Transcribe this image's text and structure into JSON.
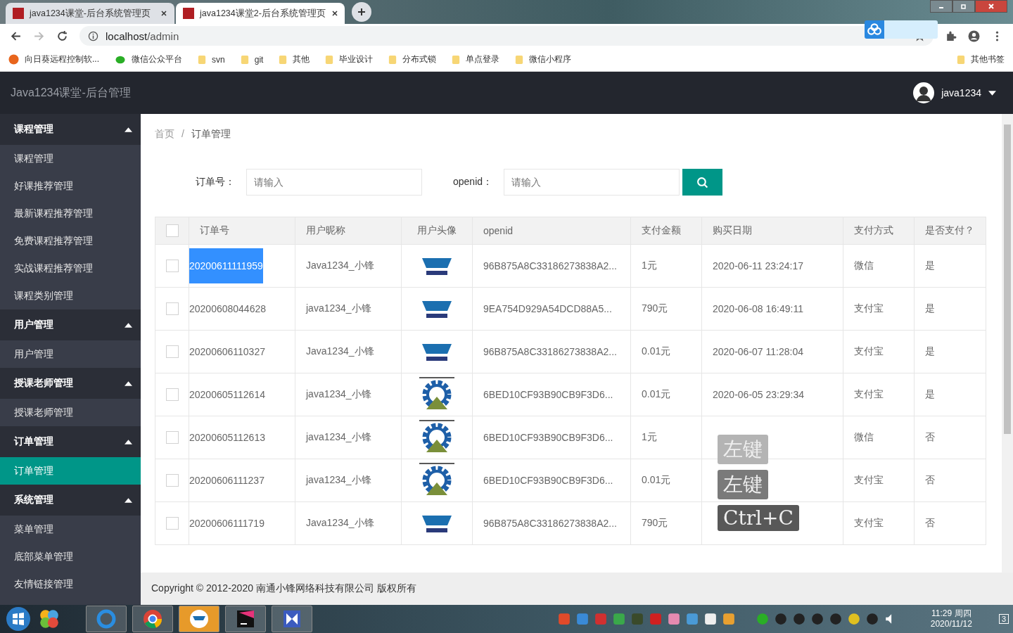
{
  "browser": {
    "tabs": [
      {
        "title": "java1234课堂-后台系统管理页",
        "selected": false
      },
      {
        "title": "java1234课堂2-后台系统管理页",
        "selected": true
      }
    ],
    "address": {
      "host": "localhost",
      "path": "/admin"
    },
    "bookmarks": [
      {
        "label": "向日葵远程控制软...",
        "kind": "app"
      },
      {
        "label": "微信公众平台",
        "kind": "wechat"
      },
      {
        "label": "svn",
        "kind": "folder"
      },
      {
        "label": "git",
        "kind": "folder"
      },
      {
        "label": "其他",
        "kind": "folder"
      },
      {
        "label": "毕业设计",
        "kind": "folder"
      },
      {
        "label": "分布式锁",
        "kind": "folder"
      },
      {
        "label": "单点登录",
        "kind": "folder"
      },
      {
        "label": "微信小程序",
        "kind": "folder"
      }
    ],
    "other_bookmarks": "其他书签"
  },
  "header": {
    "title": "Java1234课堂-后台管理",
    "user": "java1234"
  },
  "sidebar": [
    {
      "label": "课程管理",
      "expanded": true,
      "children": [
        {
          "label": "课程管理",
          "selected": false
        },
        {
          "label": "好课推荐管理",
          "selected": false
        },
        {
          "label": "最新课程推荐管理",
          "selected": false
        },
        {
          "label": "免费课程推荐管理",
          "selected": false
        },
        {
          "label": "实战课程推荐管理",
          "selected": false
        },
        {
          "label": "课程类别管理",
          "selected": false
        }
      ]
    },
    {
      "label": "用户管理",
      "expanded": true,
      "children": [
        {
          "label": "用户管理",
          "selected": false
        }
      ]
    },
    {
      "label": "授课老师管理",
      "expanded": true,
      "children": [
        {
          "label": "授课老师管理",
          "selected": false
        }
      ]
    },
    {
      "label": "订单管理",
      "expanded": true,
      "children": [
        {
          "label": "订单管理",
          "selected": true
        }
      ]
    },
    {
      "label": "系统管理",
      "expanded": true,
      "children": [
        {
          "label": "菜单管理",
          "selected": false
        },
        {
          "label": "底部菜单管理",
          "selected": false
        },
        {
          "label": "友情链接管理",
          "selected": false
        }
      ]
    }
  ],
  "breadcrumb": [
    "首页",
    "订单管理"
  ],
  "breadcrumb_separator": "/",
  "search": [
    {
      "label": "订单号：",
      "placeholder": "请输入"
    },
    {
      "label": "openid：",
      "placeholder": "请输入"
    }
  ],
  "table": {
    "all_checked": false,
    "columns": [
      "订单号",
      "用户昵称",
      "用户头像",
      "openid",
      "支付金额",
      "购买日期",
      "支付方式",
      "是否支付？"
    ],
    "rows": [
      {
        "checked": false,
        "order_no": "20200611111959",
        "order_highlighted": true,
        "nickname": "Java1234_小锋",
        "kind": "java",
        "openid": "96B875A8C33186273838A2...",
        "amount": "1元",
        "date": "2020-06-11 23:24:17",
        "pay_method": "微信",
        "paid": "是"
      },
      {
        "checked": false,
        "order_no": "20200608044628",
        "order_highlighted": false,
        "nickname": "java1234_小锋",
        "kind": "java",
        "openid": "9EA754D929A54DCD88A5...",
        "amount": "790元",
        "date": "2020-06-08 16:49:11",
        "pay_method": "支付宝",
        "paid": "是"
      },
      {
        "checked": false,
        "order_no": "20200606110327",
        "order_highlighted": false,
        "nickname": "Java1234_小锋",
        "kind": "java",
        "openid": "96B875A8C33186273838A2...",
        "amount": "0.01元",
        "date": "2020-06-07 11:28:04",
        "pay_method": "支付宝",
        "paid": "是"
      },
      {
        "checked": false,
        "order_no": "20200605112614",
        "order_highlighted": false,
        "nickname": "java1234_小锋",
        "kind": "gear",
        "openid": "6BED10CF93B90CB9F3D6...",
        "amount": "0.01元",
        "date": "2020-06-05 23:29:34",
        "pay_method": "支付宝",
        "paid": "是"
      },
      {
        "checked": false,
        "order_no": "20200605112613",
        "order_highlighted": false,
        "nickname": "java1234_小锋",
        "kind": "gear",
        "openid": "6BED10CF93B90CB9F3D6...",
        "amount": "1元",
        "date": "",
        "pay_method": "微信",
        "paid": "否"
      },
      {
        "checked": false,
        "order_no": "20200606111237",
        "order_highlighted": false,
        "nickname": "java1234_小锋",
        "kind": "gear",
        "openid": "6BED10CF93B90CB9F3D6...",
        "amount": "0.01元",
        "date": "",
        "pay_method": "支付宝",
        "paid": "否"
      },
      {
        "checked": false,
        "order_no": "20200606111719",
        "order_highlighted": false,
        "nickname": "Java1234_小锋",
        "kind": "java",
        "openid": "96B875A8C33186273838A2...",
        "amount": "790元",
        "date": "",
        "pay_method": "支付宝",
        "paid": "否"
      }
    ]
  },
  "key_overlays": [
    "左键",
    "左键",
    "Ctrl+C"
  ],
  "footer": "Copyright © 2012-2020 南通小锋网络科技有限公司 版权所有",
  "taskbar": {
    "time": "11:29 周四",
    "date": "2020/11/12",
    "notification_count": "3"
  }
}
